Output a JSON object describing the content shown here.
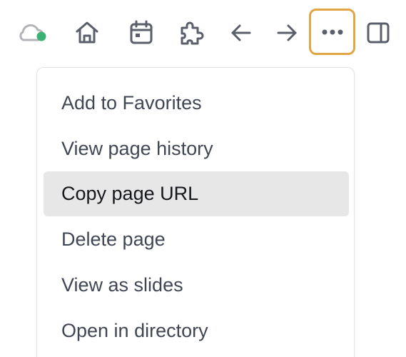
{
  "toolbar": {
    "icons": [
      {
        "name": "cloud-sync-icon",
        "status_color": "#3bb273"
      },
      {
        "name": "home-icon"
      },
      {
        "name": "calendar-icon"
      },
      {
        "name": "puzzle-icon"
      },
      {
        "name": "arrow-left-icon"
      },
      {
        "name": "arrow-right-icon"
      },
      {
        "name": "more-horizontal-icon",
        "highlight_color": "#e2a544"
      },
      {
        "name": "sidebar-toggle-icon"
      }
    ],
    "icon_color": "#5a5f6b"
  },
  "menu": {
    "items": [
      {
        "label": "Add to Favorites"
      },
      {
        "label": "View page history"
      },
      {
        "label": "Copy page URL",
        "hovered": true
      },
      {
        "label": "Delete page"
      },
      {
        "label": "View as slides"
      },
      {
        "label": "Open in directory"
      }
    ]
  }
}
